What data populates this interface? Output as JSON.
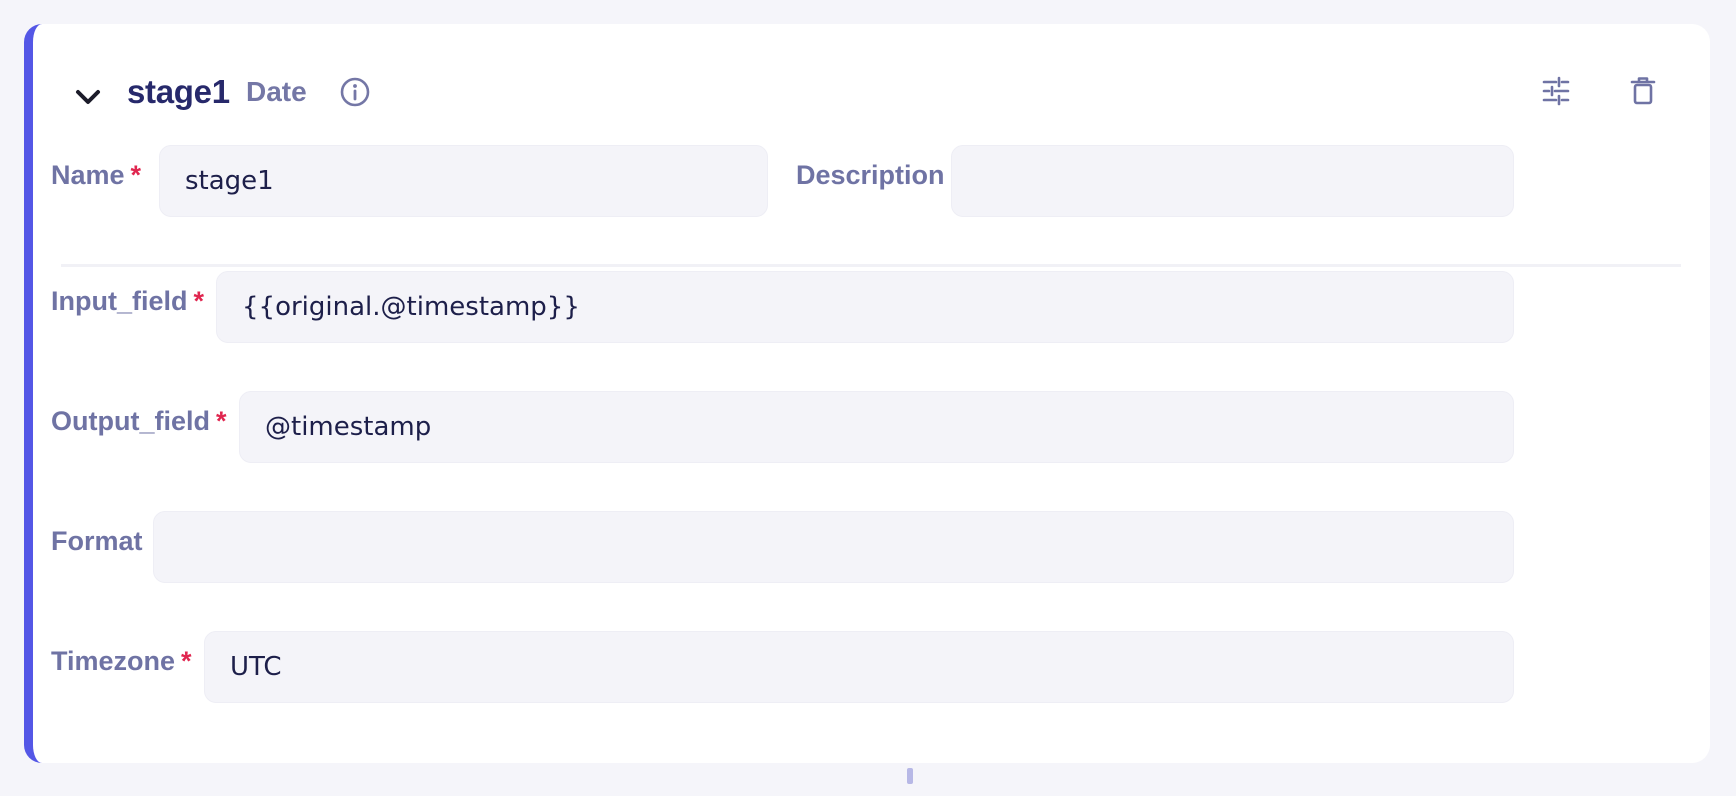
{
  "stage": {
    "title": "stage1",
    "type": "Date"
  },
  "icons": {
    "collapse": "chevron-down-icon",
    "info": "info-circle-icon",
    "settings": "sliders-icon",
    "delete": "trash-icon"
  },
  "fields": {
    "name": {
      "label": "Name",
      "required_mark": "*",
      "value": "stage1"
    },
    "description": {
      "label": "Description",
      "value": ""
    },
    "input_field": {
      "label": "Input_field",
      "required_mark": "*",
      "value": "{{original.@timestamp}}"
    },
    "output_field": {
      "label": "Output_field",
      "required_mark": "*",
      "value": "@timestamp"
    },
    "format": {
      "label": "Format",
      "value": ""
    },
    "timezone": {
      "label": "Timezone",
      "required_mark": "*",
      "value": "UTC"
    }
  },
  "colors": {
    "accent": "#5457e6",
    "title": "#27296b",
    "label": "#6f73a4",
    "required": "#e0264f",
    "field_bg": "#f4f4f9",
    "page_bg": "#f5f5fa"
  }
}
